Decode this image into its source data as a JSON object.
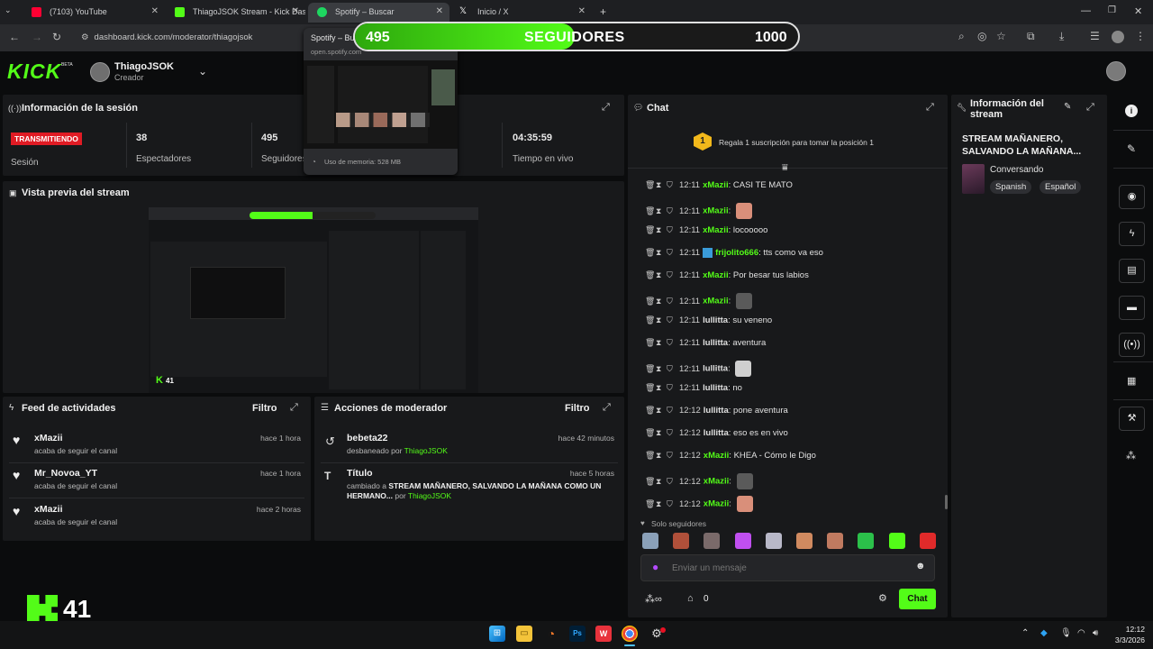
{
  "browser": {
    "tabs": [
      {
        "label": "(7103) YouTube",
        "color": "#ff0033"
      },
      {
        "label": "ThiagoJSOK Stream - Kick Dash",
        "color": "#53fc18"
      },
      {
        "label": "Spotify – Buscar",
        "color": "#1ed760"
      },
      {
        "label": "Inicio / X",
        "color": "#ffffff"
      }
    ],
    "url": "dashboard.kick.com/moderator/thiagojsok",
    "hover_card": {
      "title": "Spotify – Bu",
      "domain": "open.spotify.com",
      "memory": "Uso de memoria: 528 MB"
    }
  },
  "overlay": {
    "current": "495",
    "label": "SEGUIDORES",
    "goal": "1000",
    "progress": 0.495
  },
  "header": {
    "logo": "KICK",
    "beta": "BETA",
    "username": "ThiagoJSOK",
    "role": "Creador"
  },
  "session": {
    "title": "Información de la sesión",
    "live_badge": "TRANSMITIENDO",
    "session_label": "Sesión",
    "viewers": "38",
    "viewers_label": "Espectadores",
    "followers": "495",
    "followers_label": "Seguidores",
    "uptime": "04:35:59",
    "uptime_label": "Tiempo en vivo"
  },
  "preview": {
    "title": "Vista previa del stream"
  },
  "activity": {
    "title": "Feed de actividades",
    "filter": "Filtro",
    "items": [
      {
        "user": "xMazii",
        "desc": "acaba de seguir el canal",
        "time": "hace 1 hora"
      },
      {
        "user": "Mr_Novoa_YT",
        "desc": "acaba de seguir el canal",
        "time": "hace 1 hora"
      },
      {
        "user": "xMazii",
        "desc": "acaba de seguir el canal",
        "time": "hace 2 horas"
      }
    ]
  },
  "modactions": {
    "title": "Acciones de moderador",
    "filter": "Filtro",
    "items": [
      {
        "name": "bebeta22",
        "desc": "desbaneado por",
        "by": "ThiagoJSOK",
        "time": "hace 42 minutos"
      },
      {
        "name": "Título",
        "desc_prefix": "cambiado a",
        "desc_bold": "STREAM MAÑANERO, SALVANDO LA MAÑANA COMO UN HERMANO...",
        "desc_by": "por",
        "by": "ThiagoJSOK",
        "time": "hace 5 horas"
      }
    ]
  },
  "chat": {
    "title": "Chat",
    "gift_rank": "1",
    "gift_text": "Regala 1 suscripción para tomar la posición 1",
    "messages": [
      {
        "time": "12:11",
        "user": "xMazii",
        "text": "CASI TE MATO",
        "color": "#53fc18"
      },
      {
        "time": "12:11",
        "user": "xMazii",
        "text": "",
        "emote": "#d98f7a",
        "color": "#53fc18"
      },
      {
        "time": "12:11",
        "user": "xMazii",
        "text": "locooooo",
        "color": "#53fc18"
      },
      {
        "time": "12:11",
        "user": "frijolito666",
        "text": "tts como va eso",
        "color": "#53fc18",
        "badge": true
      },
      {
        "time": "12:11",
        "user": "xMazii",
        "text": "Por besar tus labios",
        "color": "#53fc18"
      },
      {
        "time": "12:11",
        "user": "xMazii",
        "text": "",
        "emote": "#5a5a5a",
        "color": "#53fc18"
      },
      {
        "time": "12:11",
        "user": "lullitta",
        "text": "su veneno",
        "color": "#e0e0e0"
      },
      {
        "time": "12:11",
        "user": "lullitta",
        "text": "aventura",
        "color": "#e0e0e0"
      },
      {
        "time": "12:11",
        "user": "lullitta",
        "text": "",
        "emote": "#cfcfcf",
        "color": "#e0e0e0"
      },
      {
        "time": "12:11",
        "user": "lullitta",
        "text": "no",
        "color": "#e0e0e0"
      },
      {
        "time": "12:12",
        "user": "lullitta",
        "text": "pone aventura",
        "color": "#e0e0e0"
      },
      {
        "time": "12:12",
        "user": "lullitta",
        "text": "eso es en vivo",
        "color": "#e0e0e0"
      },
      {
        "time": "12:12",
        "user": "xMazii",
        "text": "KHEA - Cómo le Digo",
        "color": "#53fc18"
      },
      {
        "time": "12:12",
        "user": "xMazii",
        "text": "",
        "emote": "#5a5a5a",
        "color": "#53fc18"
      },
      {
        "time": "12:12",
        "user": "xMazii",
        "text": "",
        "emote": "#d98f7a",
        "color": "#53fc18"
      }
    ],
    "followers_only": "Solo seguidores",
    "input_placeholder": "Enviar un mensaje",
    "points": "0",
    "send_label": "Chat"
  },
  "stream_info": {
    "title": "Información del stream",
    "stream_title": "STREAM MAÑANERO, SALVANDO LA MAÑANA...",
    "category": "Conversando",
    "tags": [
      "Spanish",
      "Español"
    ]
  },
  "cam_overlay": {
    "number": "41"
  },
  "taskbar": {
    "time": "12:12",
    "date": "3/3/2026"
  }
}
